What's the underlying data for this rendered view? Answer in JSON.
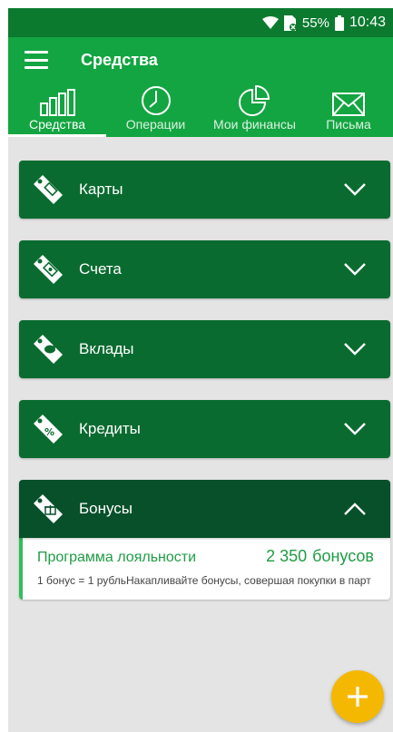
{
  "status_bar": {
    "battery_percent": "55%",
    "time": "10:43",
    "icons": [
      "wifi-icon",
      "sim-no-signal-icon",
      "battery-icon"
    ]
  },
  "app_bar": {
    "title": "Средства",
    "menu_icon": "hamburger-menu-icon"
  },
  "tabs": [
    {
      "label": "Средства",
      "icon": "bar-chart-icon",
      "active": true
    },
    {
      "label": "Операции",
      "icon": "clock-icon",
      "active": false
    },
    {
      "label": "Мои финансы",
      "icon": "pie-chart-icon",
      "active": false
    },
    {
      "label": "Письма",
      "icon": "envelope-icon",
      "active": false
    }
  ],
  "sections": [
    {
      "label": "Карты",
      "icon": "card-tag-icon",
      "expanded": false
    },
    {
      "label": "Счета",
      "icon": "money-tag-icon",
      "expanded": false
    },
    {
      "label": "Вклады",
      "icon": "piggy-bank-tag-icon",
      "expanded": false
    },
    {
      "label": "Кредиты",
      "icon": "percent-tag-icon",
      "expanded": false
    },
    {
      "label": "Бонусы",
      "icon": "gift-tag-icon",
      "expanded": true
    }
  ],
  "bonus": {
    "title": "Программа лояльности",
    "amount": "2 350",
    "unit": "бонусов",
    "note": "1 бонус = 1 рубльНакапливайте бонусы, совершая покупки в парт"
  },
  "fab": {
    "icon": "plus-icon"
  },
  "colors": {
    "status_bar": "#0b7a2f",
    "app_bar": "#13a541",
    "section": "#0a6b30",
    "section_open": "#07502a",
    "accent_text": "#1f9c45",
    "fab": "#f5b800"
  }
}
